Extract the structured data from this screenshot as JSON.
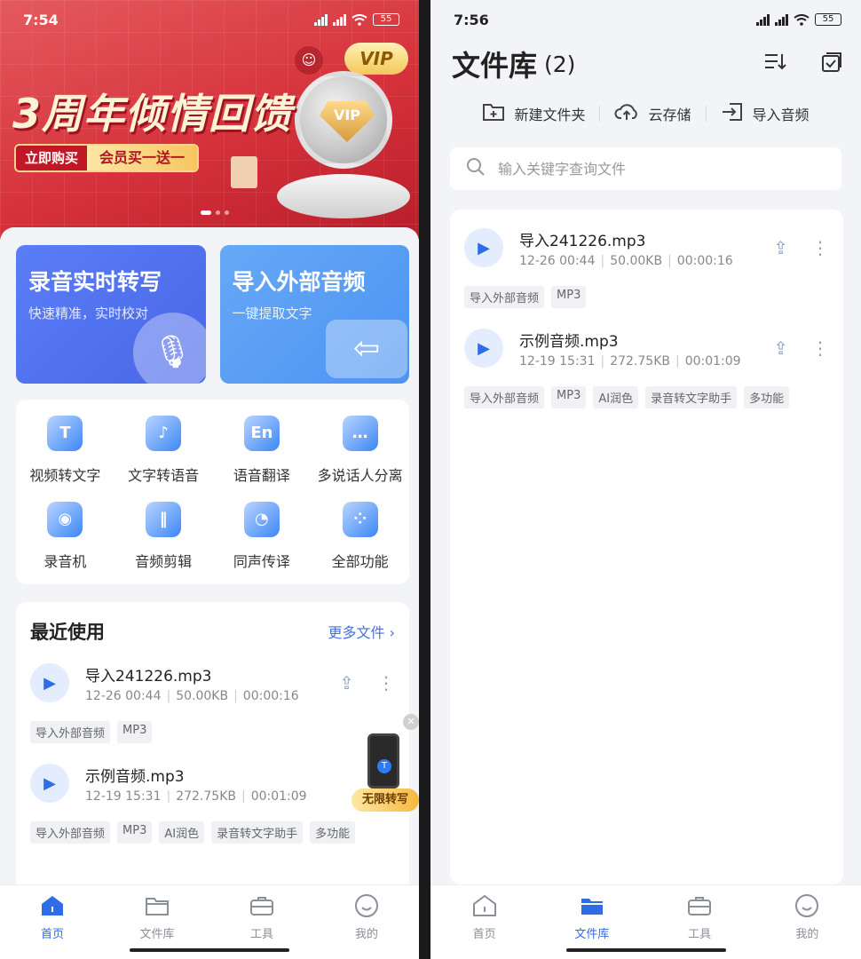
{
  "left": {
    "status": {
      "time": "7:54",
      "battery": "55"
    },
    "banner": {
      "title": "3周年倾情回馈",
      "buy_now": "立即购买",
      "promo": "会员买一送一",
      "vip_badge": "VIP",
      "medal_text": "VIP"
    },
    "feature_cards": [
      {
        "title": "录音实时转写",
        "subtitle": "快速精准，实时校对"
      },
      {
        "title": "导入外部音频",
        "subtitle": "一键提取文字"
      }
    ],
    "tools": [
      {
        "label": "视频转文字",
        "glyph": "T"
      },
      {
        "label": "文字转语音",
        "glyph": "♪"
      },
      {
        "label": "语音翻译",
        "glyph": "En"
      },
      {
        "label": "多说话人分离",
        "glyph": "…"
      },
      {
        "label": "录音机",
        "glyph": "◉"
      },
      {
        "label": "音频剪辑",
        "glyph": "‖"
      },
      {
        "label": "同声传译",
        "glyph": "◔"
      },
      {
        "label": "全部功能",
        "glyph": "⁘"
      }
    ],
    "recent": {
      "title": "最近使用",
      "more": "更多文件",
      "files": [
        {
          "name": "导入241226.mp3",
          "date": "12-26 00:44",
          "size": "50.00KB",
          "duration": "00:00:16",
          "tags": [
            "导入外部音频",
            "MP3"
          ]
        },
        {
          "name": "示例音频.mp3",
          "date": "12-19 15:31",
          "size": "272.75KB",
          "duration": "00:01:09",
          "tags": [
            "导入外部音频",
            "MP3",
            "AI润色",
            "录音转文字助手",
            "多功能"
          ]
        }
      ]
    },
    "float_ad": {
      "caption": "无限转写",
      "glyph": "T"
    },
    "active_tab": 0
  },
  "right": {
    "status": {
      "time": "7:56",
      "battery": "55"
    },
    "header": {
      "title": "文件库",
      "count": "(2)"
    },
    "actions": [
      {
        "label": "新建文件夹",
        "icon": "new-folder-icon"
      },
      {
        "label": "云存储",
        "icon": "cloud-upload-icon"
      },
      {
        "label": "导入音频",
        "icon": "import-icon"
      }
    ],
    "search": {
      "placeholder": "输入关键字查询文件"
    },
    "files": [
      {
        "name": "导入241226.mp3",
        "date": "12-26 00:44",
        "size": "50.00KB",
        "duration": "00:00:16",
        "tags": [
          "导入外部音频",
          "MP3"
        ]
      },
      {
        "name": "示例音频.mp3",
        "date": "12-19 15:31",
        "size": "272.75KB",
        "duration": "00:01:09",
        "tags": [
          "导入外部音频",
          "MP3",
          "AI润色",
          "录音转文字助手",
          "多功能"
        ]
      }
    ],
    "active_tab": 1
  },
  "tabbar": [
    {
      "label": "首页",
      "icon": "home-icon"
    },
    {
      "label": "文件库",
      "icon": "folder-icon"
    },
    {
      "label": "工具",
      "icon": "toolbox-icon"
    },
    {
      "label": "我的",
      "icon": "profile-icon"
    }
  ],
  "colors": {
    "accent": "#2f6de6",
    "banner_red": "#d6323b"
  }
}
